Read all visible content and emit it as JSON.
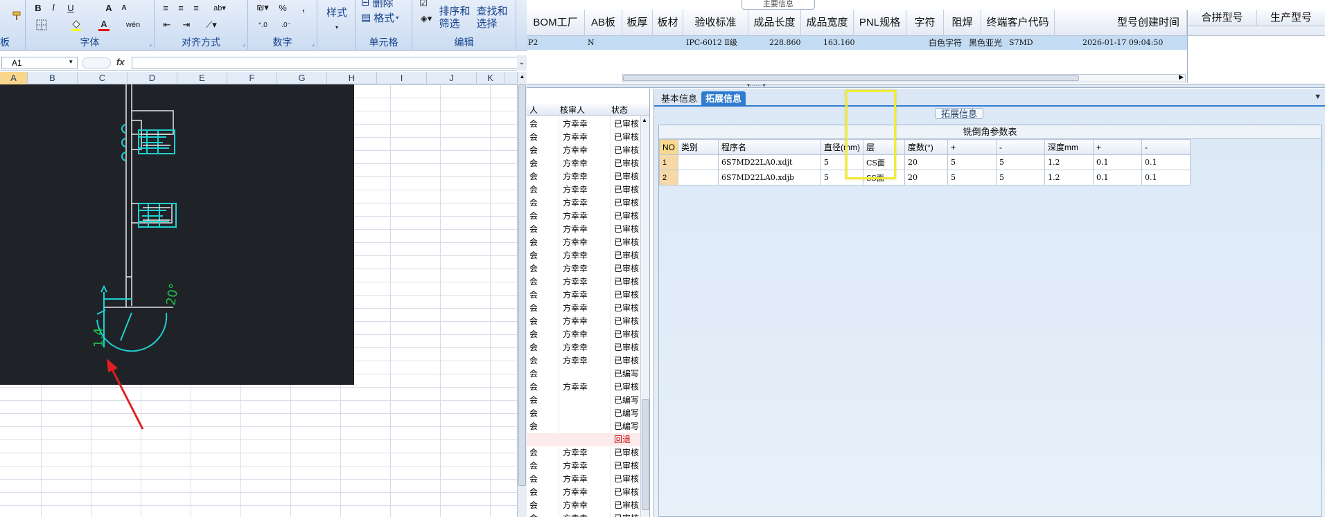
{
  "excel": {
    "ribbon": {
      "groups": {
        "font_label": "字体",
        "align_label": "对齐方式",
        "number_label": "数字",
        "cells_label": "单元格",
        "edit_label": "编辑",
        "clipboard_label": "板"
      },
      "buttons": {
        "bold": "B",
        "italic": "I",
        "underline": "U",
        "font_grow": "A",
        "font_shrink": "A",
        "font_color": "A",
        "percent": "%",
        "comma": ",",
        "style": "样式",
        "delete": "删除",
        "format": "格式",
        "sort_filter": "排序和\n筛选",
        "find_select": "查找和\n选择",
        "wrap": "wén"
      }
    },
    "name_box": "A1",
    "fx": "fx",
    "columns": [
      "A",
      "B",
      "C",
      "D",
      "E",
      "F",
      "G",
      "H",
      "I",
      "J",
      "K"
    ],
    "selected_column": "A",
    "drawing": {
      "dim_depth": "1.4",
      "dim_angle": "20°"
    }
  },
  "app": {
    "main_label": "主要信息",
    "headers": [
      "BOM工厂",
      "AB板",
      "板厚",
      "板材",
      "验收标准",
      "成品长度",
      "成品宽度",
      "PNL规格",
      "字符",
      "阻焊",
      "终端客户代码",
      "型号创建时间"
    ],
    "side_headers": [
      "合拼型号",
      "生产型号"
    ],
    "selected_row": {
      "c0": "P2",
      "ab": "N",
      "standard": "IPC-6012 Ⅱ级",
      "length": "228.860",
      "width": "163.160",
      "char": "白色字符",
      "mask": "黑色亚光",
      "customer": "S7MD",
      "created": "2026-01-17 09:04:50"
    },
    "list": {
      "headers": [
        "人",
        "核审人",
        "状态"
      ],
      "rows": [
        {
          "a": "会",
          "b": "方幸幸",
          "c": "已审核"
        },
        {
          "a": "会",
          "b": "方幸幸",
          "c": "已审核"
        },
        {
          "a": "会",
          "b": "方幸幸",
          "c": "已审核"
        },
        {
          "a": "会",
          "b": "方幸幸",
          "c": "已审核"
        },
        {
          "a": "会",
          "b": "方幸幸",
          "c": "已审核"
        },
        {
          "a": "会",
          "b": "方幸幸",
          "c": "已审核"
        },
        {
          "a": "会",
          "b": "方幸幸",
          "c": "已审核"
        },
        {
          "a": "会",
          "b": "方幸幸",
          "c": "已审核"
        },
        {
          "a": "会",
          "b": "方幸幸",
          "c": "已审核"
        },
        {
          "a": "会",
          "b": "方幸幸",
          "c": "已审核"
        },
        {
          "a": "会",
          "b": "方幸幸",
          "c": "已审核"
        },
        {
          "a": "会",
          "b": "方幸幸",
          "c": "已审核"
        },
        {
          "a": "会",
          "b": "方幸幸",
          "c": "已审核"
        },
        {
          "a": "会",
          "b": "方幸幸",
          "c": "已审核"
        },
        {
          "a": "会",
          "b": "方幸幸",
          "c": "已审核"
        },
        {
          "a": "会",
          "b": "方幸幸",
          "c": "已审核"
        },
        {
          "a": "会",
          "b": "方幸幸",
          "c": "已审核"
        },
        {
          "a": "会",
          "b": "方幸幸",
          "c": "已审核"
        },
        {
          "a": "会",
          "b": "方幸幸",
          "c": "已审核"
        },
        {
          "a": "会",
          "b": "",
          "c": "已编写"
        },
        {
          "a": "会",
          "b": "方幸幸",
          "c": "已审核"
        },
        {
          "a": "会",
          "b": "",
          "c": "已编写"
        },
        {
          "a": "会",
          "b": "",
          "c": "已编写"
        },
        {
          "a": "会",
          "b": "",
          "c": "已编写"
        },
        {
          "a": "",
          "b": "",
          "c": "回退"
        },
        {
          "a": "会",
          "b": "方幸幸",
          "c": "已审核"
        },
        {
          "a": "会",
          "b": "方幸幸",
          "c": "已审核"
        },
        {
          "a": "会",
          "b": "方幸幸",
          "c": "已审核"
        },
        {
          "a": "会",
          "b": "方幸幸",
          "c": "已审核"
        },
        {
          "a": "会",
          "b": "方幸幸",
          "c": "已审核"
        },
        {
          "a": "会",
          "b": "方幸幸",
          "c": "已审核"
        }
      ]
    },
    "tabs": {
      "basic": "基本信息",
      "ext": "拓展信息"
    },
    "ext_label": "拓展信息",
    "grid": {
      "title": "铣倒角参数表",
      "columns": [
        "NO",
        "类别",
        "程序名",
        "直径(mm)",
        "层",
        "度数(°)",
        "+",
        "-",
        "深度mm",
        "+",
        "-"
      ],
      "rows": [
        [
          "1",
          "",
          "6S7MD22LA0.xdjt",
          "5",
          "CS面",
          "20",
          "5",
          "5",
          "1.2",
          "0.1",
          "0.1"
        ],
        [
          "2",
          "",
          "6S7MD22LA0.xdjb",
          "5",
          "SS面",
          "20",
          "5",
          "5",
          "1.2",
          "0.1",
          "0.1"
        ]
      ]
    },
    "colors": {
      "highlight": "#f0ea3a",
      "tab_active": "#2f7bd0",
      "selected_row": "#c3dcf4"
    }
  }
}
